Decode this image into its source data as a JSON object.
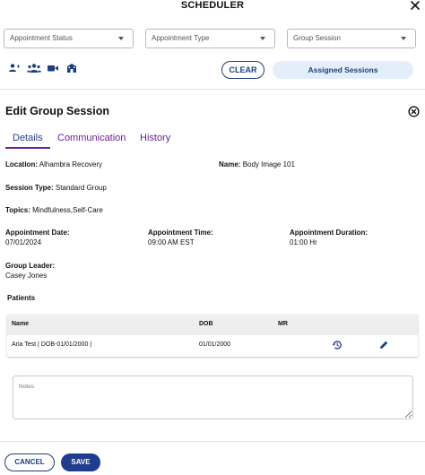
{
  "header": {
    "title": "SCHEDULER",
    "close_icon": "close-icon"
  },
  "filters": {
    "appointment_status": "Appointment Status",
    "appointment_type": "Appointment Type",
    "group_session": "Group Session"
  },
  "toolbar": {
    "icons": [
      "person-icon",
      "people-group-icon",
      "video-camera-icon",
      "building-icon"
    ],
    "clear_label": "CLEAR",
    "assigned_label": "Assigned Sessions"
  },
  "panel": {
    "title": "Edit Group Session",
    "tabs": [
      "Details",
      "Communication",
      "History"
    ]
  },
  "details": {
    "location_label": "Location:",
    "location_value": "Alhambra Recovery",
    "name_label": "Name:",
    "name_value": "Body Image 101",
    "session_type_label": "Session Type:",
    "session_type_value": "Standard Group",
    "topics_label": "Topics:",
    "topics_value": "Mindfulness,Self-Care",
    "appt_date_label": "Appointment Date:",
    "appt_date_value": "07/01/2024",
    "appt_time_label": "Appointment Time:",
    "appt_time_value": "09:00 AM EST",
    "appt_duration_label": "Appointment Duration:",
    "appt_duration_value": "01:00 Hr",
    "group_leader_label": "Group Leader:",
    "group_leader_value": "Casey Jones"
  },
  "patients": {
    "heading": "Patients",
    "columns": [
      "Name",
      "DOB",
      "MR"
    ],
    "rows": [
      {
        "name": "Aria Test | DOB-01/01/2000 |",
        "dob": "01/01/2000",
        "mr": ""
      }
    ]
  },
  "notes": {
    "placeholder": "Notes",
    "value": ""
  },
  "footer": {
    "cancel_label": "CANCEL",
    "save_label": "SAVE"
  },
  "colors": {
    "primary": "#1f3d8f",
    "tab_purple": "#6a1f96",
    "assigned_bg": "#e3eefa"
  }
}
